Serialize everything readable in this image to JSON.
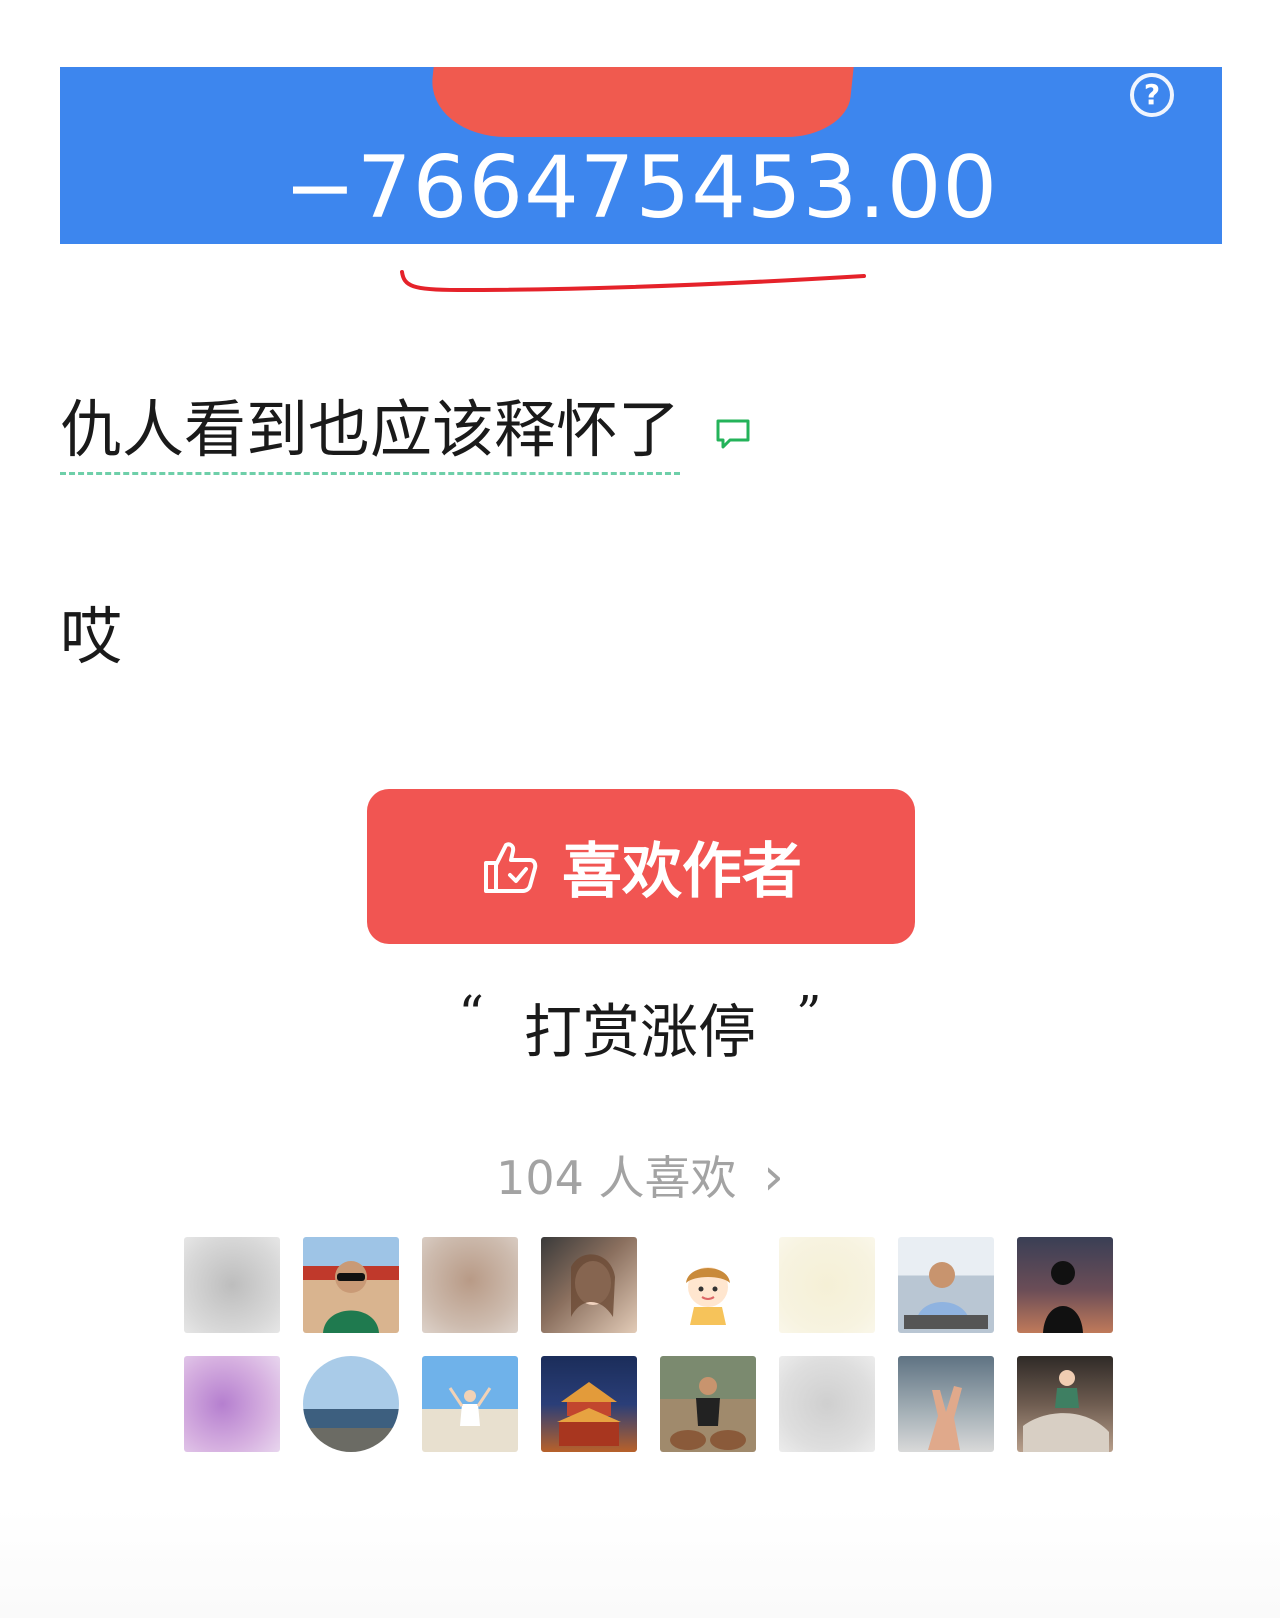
{
  "banner": {
    "amount": "−766475453.00",
    "help_icon": "question-circle-icon",
    "help_glyph": "?",
    "background": "#3d86ee"
  },
  "post": {
    "line1": "仇人看到也应该释怀了",
    "line2": "哎"
  },
  "like_button": {
    "icon": "thumbs-up-icon",
    "label": "喜欢作者",
    "color": "#f15552"
  },
  "reward": {
    "open_quote": "“",
    "label": "打赏涨停",
    "close_quote": "”"
  },
  "likes": {
    "text": "104 人喜欢",
    "chevron": "›"
  },
  "avatars": [
    {
      "id": "avatar-1",
      "style": "blur-gray"
    },
    {
      "id": "avatar-2",
      "style": "man-sunglasses"
    },
    {
      "id": "avatar-3",
      "style": "blur-brown"
    },
    {
      "id": "avatar-4",
      "style": "woman-portrait"
    },
    {
      "id": "avatar-5",
      "style": "cartoon-girl"
    },
    {
      "id": "avatar-6",
      "style": "blur-cream"
    },
    {
      "id": "avatar-7",
      "style": "man-office"
    },
    {
      "id": "avatar-8",
      "style": "silhouette-sunset"
    },
    {
      "id": "avatar-9",
      "style": "blur-purple"
    },
    {
      "id": "avatar-10",
      "style": "sea-round"
    },
    {
      "id": "avatar-11",
      "style": "beach-jump"
    },
    {
      "id": "avatar-12",
      "style": "night-tower"
    },
    {
      "id": "avatar-13",
      "style": "man-rocks"
    },
    {
      "id": "avatar-14",
      "style": "blur-light"
    },
    {
      "id": "avatar-15",
      "style": "hand-sky"
    },
    {
      "id": "avatar-16",
      "style": "child-photo"
    }
  ]
}
